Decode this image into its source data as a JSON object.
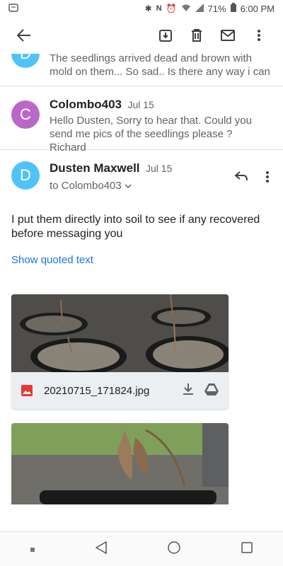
{
  "status_bar": {
    "battery": "71%",
    "time": "6:00 PM"
  },
  "messages": [
    {
      "avatar_letter": "D",
      "avatar_color": "#4fc3f7",
      "snippet": "The seedlings arrived dead and brown with mold on them... So sad.. Is there any way i can"
    },
    {
      "avatar_letter": "C",
      "avatar_color": "#ba68c8",
      "sender": "Colombo403",
      "date": "Jul 15",
      "snippet": "Hello Dusten, Sorry to hear that. Could you send me pics of the seedlings please ? Richard"
    }
  ],
  "open_message": {
    "avatar_letter": "D",
    "avatar_color": "#4fc3f7",
    "sender": "Dusten Maxwell",
    "date": "Jul 15",
    "to": "to Colombo403",
    "body": "I put them directly into soil to see if any recovered before messaging you",
    "show_quoted": "Show quoted text"
  },
  "attachments": [
    {
      "filename": "20210715_171824.jpg"
    }
  ]
}
